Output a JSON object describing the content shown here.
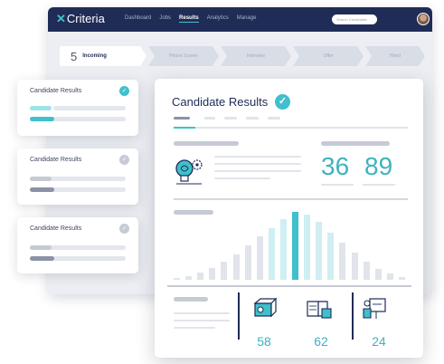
{
  "app": {
    "logo": "Criteria",
    "nav": [
      "Dashboard",
      "Jobs",
      "Results",
      "Analytics",
      "Manage"
    ],
    "active_nav": "Results",
    "search_placeholder": "Search Candidates"
  },
  "pipeline": {
    "first": {
      "count": "5",
      "label": "Incoming"
    },
    "stages": [
      "Phone Screen",
      "Interview",
      "Offer",
      "Hired"
    ]
  },
  "side_cards": [
    {
      "title": "Candidate Results",
      "status": "complete"
    },
    {
      "title": "Candidate Results",
      "status": "pending"
    },
    {
      "title": "Candidate Results",
      "status": "pending"
    }
  ],
  "main_card": {
    "title": "Candidate Results",
    "scores": [
      "36",
      "89"
    ],
    "stats": [
      "58",
      "62",
      "24"
    ]
  },
  "histogram": {
    "values": [
      0.02,
      0.05,
      0.1,
      0.16,
      0.24,
      0.34,
      0.46,
      0.58,
      0.7,
      0.82,
      0.92,
      0.88,
      0.78,
      0.64,
      0.5,
      0.36,
      0.24,
      0.15,
      0.08,
      0.04
    ],
    "highlight_index": 10
  },
  "colors": {
    "navy": "#1f2c56",
    "accent": "#3fc0cc",
    "bar": "#e1e4ea",
    "bar_soft": "#cfeff2"
  },
  "icons": [
    "brain-gear-icon",
    "machine-icon",
    "book-icon",
    "person-board-icon"
  ]
}
